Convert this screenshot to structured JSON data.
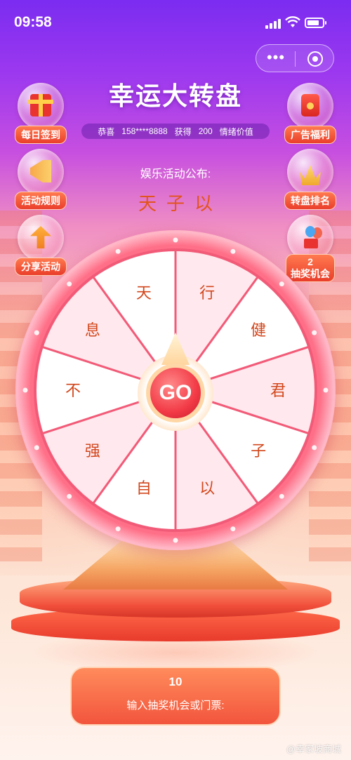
{
  "status_bar": {
    "time": "09:58"
  },
  "header": {
    "title": "幸运大转盘"
  },
  "notice": {
    "prefix": "恭喜",
    "phone": "158****8888",
    "verb": "获得",
    "amount": "200",
    "suffix": "情绪价值"
  },
  "side_left": [
    {
      "label": "每日签到",
      "icon": "gift-icon"
    },
    {
      "label": "活动规则",
      "icon": "megaphone-icon"
    },
    {
      "label": "分享活动",
      "icon": "arrow-up-icon"
    }
  ],
  "side_right": [
    {
      "label": "广告福利",
      "icon": "red-packet-icon"
    },
    {
      "label": "转盘排名",
      "icon": "crown-icon"
    },
    {
      "count": "2",
      "label": "抽奖机会",
      "icon": "balloon-icon"
    }
  ],
  "announcement": {
    "label": "娱乐活动公布:",
    "text": "天子以"
  },
  "wheel": {
    "segments": [
      "天",
      "行",
      "健",
      "君",
      "子",
      "以",
      "自",
      "强",
      "不",
      "息"
    ],
    "colors": {
      "light": "#ffe9ee",
      "white": "#ffffff",
      "line": "#f25b78"
    },
    "go_label": "GO"
  },
  "bottom": {
    "chances": "10",
    "input_label": "输入抽奖机会或门票:"
  },
  "watermark": "@幸家坡商城"
}
